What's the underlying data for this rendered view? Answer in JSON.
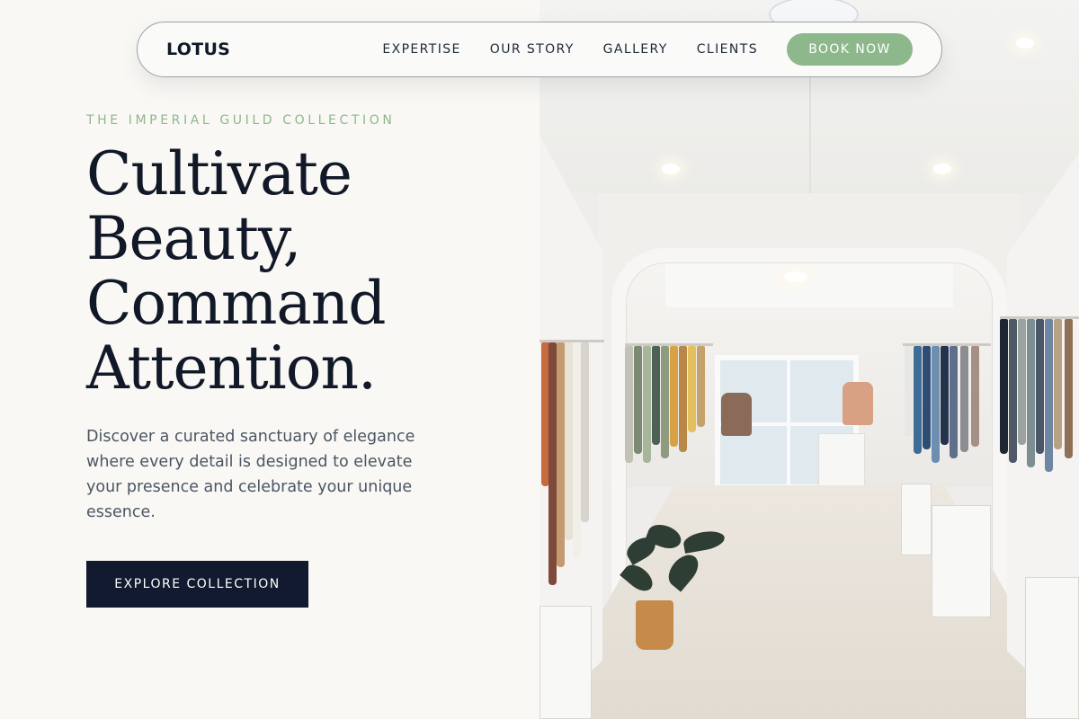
{
  "brand": {
    "logo": "LOTUS"
  },
  "nav": {
    "links": [
      "EXPERTISE",
      "OUR STORY",
      "GALLERY",
      "CLIENTS"
    ],
    "cta": "BOOK NOW"
  },
  "hero": {
    "eyebrow": "THE IMPERIAL GUILD COLLECTION",
    "headline": [
      "Cultivate",
      "Beauty,",
      "Command",
      "Attention."
    ],
    "description": "Discover a curated sanctuary of elegance where every detail is designed to elevate your presence and celebrate your unique essence.",
    "cta": "EXPLORE COLLECTION"
  },
  "colors": {
    "accent": "#8db88c",
    "ink": "#111827",
    "cta_background": "#111a2e",
    "page_background": "#f9f8f5"
  }
}
